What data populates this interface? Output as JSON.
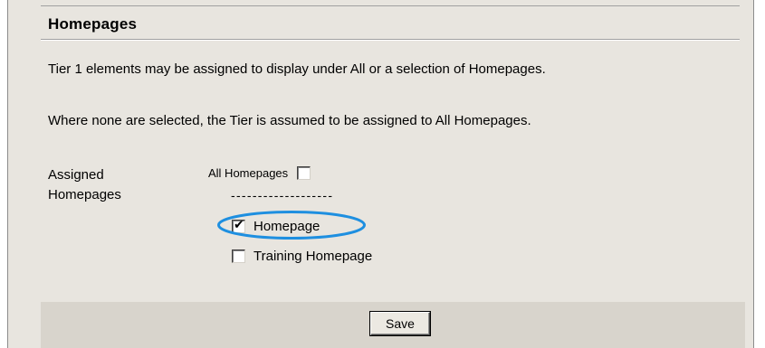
{
  "section": {
    "title": "Homepages"
  },
  "text": {
    "paragraph1": "Tier 1 elements may be assigned to display under All or a selection of Homepages.",
    "paragraph2": "Where none are selected, the Tier is assumed to be assigned to All Homepages."
  },
  "assigned": {
    "label_line1": "Assigned",
    "label_line2": "Homepages",
    "all_homepages_label": "All Homepages",
    "all_homepages_checked": false,
    "separator": "-------------------",
    "options": [
      {
        "label": "Homepage",
        "checked": true
      },
      {
        "label": "Training Homepage",
        "checked": false
      }
    ]
  },
  "footer": {
    "save_label": "Save"
  },
  "colors": {
    "panel_background": "#e8e5df",
    "footer_background": "#d8d4cc",
    "highlight_ellipse": "#1e8fe0"
  }
}
